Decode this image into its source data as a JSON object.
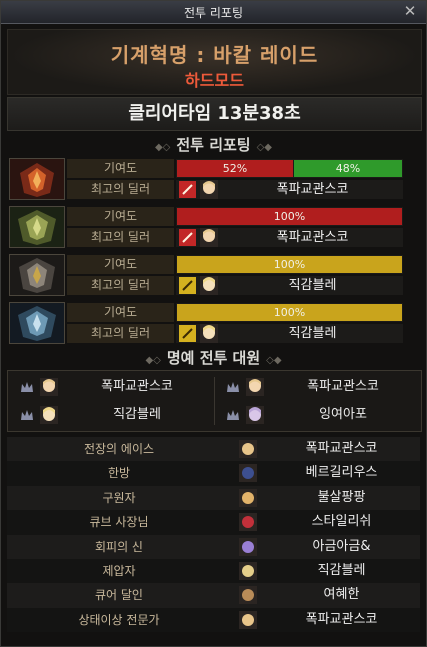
{
  "window": {
    "title": "전투 리포팅",
    "close_glyph": "✕"
  },
  "header": {
    "raid_name": "기계혁명 : 바칼 레이드",
    "mode": "하드모드"
  },
  "clear_time": "클리어타임  13분38초",
  "report": {
    "section_title": "전투 리포팅",
    "contribution_label": "기여도",
    "best_dealer_label": "최고의 딜러",
    "rows": [
      {
        "portrait_icon": "red-dragon-portrait-icon",
        "segments": [
          {
            "label": "52%",
            "value": 52,
            "color": "#b01e1e"
          },
          {
            "label": "48%",
            "value": 48,
            "color": "#2f9a2b"
          }
        ],
        "weapon_icon": "red-weapon-icon",
        "weapon_color": "#c22727",
        "dealer": "폭파교관스코"
      },
      {
        "portrait_icon": "green-dragon-portrait-icon",
        "segments": [
          {
            "label": "100%",
            "value": 100,
            "color": "#b01e1e"
          }
        ],
        "weapon_icon": "red-weapon-icon",
        "weapon_color": "#c22727",
        "dealer": "폭파교관스코"
      },
      {
        "portrait_icon": "gray-dragon-portrait-icon",
        "segments": [
          {
            "label": "100%",
            "value": 100,
            "color": "#c9a41c"
          }
        ],
        "weapon_icon": "yellow-weapon-icon",
        "weapon_color": "#d4b11f",
        "dealer": "직감블레"
      },
      {
        "portrait_icon": "blue-dragon-portrait-icon",
        "segments": [
          {
            "label": "100%",
            "value": 100,
            "color": "#c9a41c"
          }
        ],
        "weapon_icon": "yellow-weapon-icon",
        "weapon_color": "#d4b11f",
        "dealer": "직감블레"
      }
    ]
  },
  "honor": {
    "section_title": "명예 전투 대원",
    "members": [
      {
        "name": "폭파교관스코",
        "crown_icon": "crown-icon"
      },
      {
        "name": "폭파교관스코",
        "crown_icon": "crown-icon"
      },
      {
        "name": "직감블레",
        "crown_icon": "crown-icon"
      },
      {
        "name": "잉여아포",
        "crown_icon": "crown-icon"
      }
    ]
  },
  "titles": [
    {
      "title": "전장의 에이스",
      "name": "폭파교관스코",
      "avatar_color": "#e8c58a"
    },
    {
      "title": "한방",
      "name": "베르길리우스",
      "avatar_color": "#3d4f8f"
    },
    {
      "title": "구원자",
      "name": "불살팡팡",
      "avatar_color": "#e2b36a"
    },
    {
      "title": "큐브 사장님",
      "name": "스타일리쉬",
      "avatar_color": "#c2303a"
    },
    {
      "title": "회피의 신",
      "name": "아금아금&",
      "avatar_color": "#9a7fd4"
    },
    {
      "title": "제압자",
      "name": "직감블레",
      "avatar_color": "#e6cf8a"
    },
    {
      "title": "큐어 달인",
      "name": "여혜한",
      "avatar_color": "#b98c58"
    },
    {
      "title": "상태이상 전문가",
      "name": "폭파교관스코",
      "avatar_color": "#e8c58a"
    }
  ]
}
